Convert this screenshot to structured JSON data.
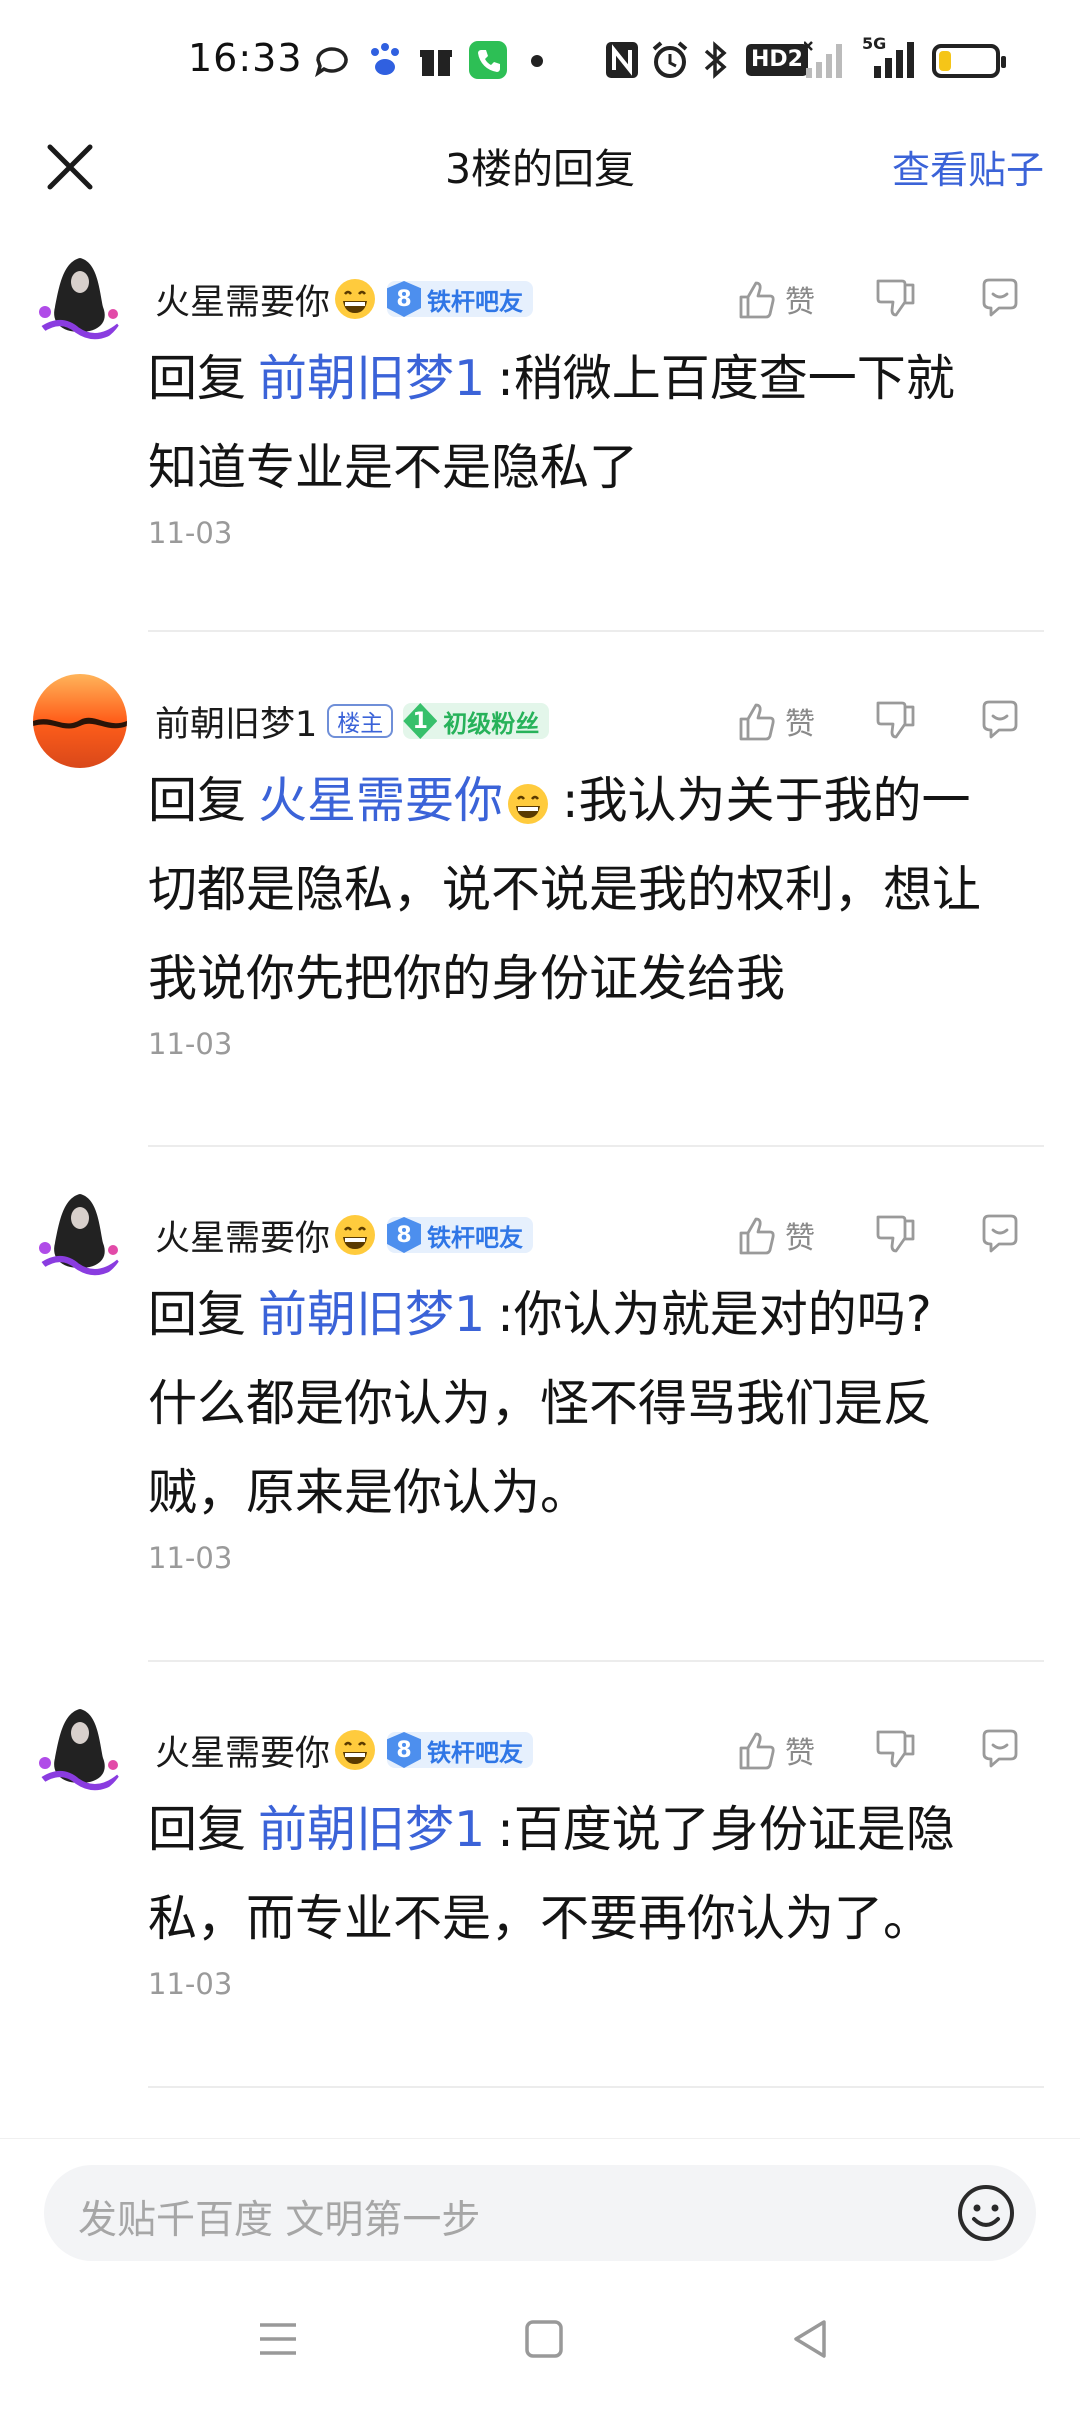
{
  "status_bar": {
    "time": "16:33",
    "network_label": "5G",
    "hd_label": "HD2",
    "battery_level": 0.2,
    "battery_color": "#f5c518"
  },
  "header": {
    "title": "3楼的回复",
    "view_post": "查看贴子",
    "close_icon": "close-icon"
  },
  "replies": [
    {
      "username": "火星需要你",
      "level": "8",
      "badge": "铁杆吧友",
      "badge_style": "blue",
      "is_owner": false,
      "prefix": "回复",
      "mention": "前朝旧梦1",
      "text_lines": [
        ":稍微上百度查一下就",
        "知道专业是不是隐私了"
      ],
      "date": "11-03",
      "like_label": "赞"
    },
    {
      "username": "前朝旧梦1",
      "owner_label": "楼主",
      "level": "1",
      "badge": "初级粉丝",
      "badge_style": "green",
      "is_owner": true,
      "prefix": "回复",
      "mention": "火星需要你",
      "text_lines": [
        ":我认为关于我的一",
        "切都是隐私，说不说是我的权利，想让",
        "我说你先把你的身份证发给我"
      ],
      "date": "11-03",
      "like_label": "赞"
    },
    {
      "username": "火星需要你",
      "level": "8",
      "badge": "铁杆吧友",
      "badge_style": "blue",
      "is_owner": false,
      "prefix": "回复",
      "mention": "前朝旧梦1",
      "text_lines": [
        ":你认为就是对的吗?",
        "什么都是你认为，怪不得骂我们是反",
        "贼，原来是你认为。"
      ],
      "date": "11-03",
      "like_label": "赞"
    },
    {
      "username": "火星需要你",
      "level": "8",
      "badge": "铁杆吧友",
      "badge_style": "blue",
      "is_owner": false,
      "prefix": "回复",
      "mention": "前朝旧梦1",
      "text_lines": [
        ":百度说了身份证是隐",
        "私，而专业不是，不要再你认为了。"
      ],
      "date": "11-03",
      "like_label": "赞"
    }
  ],
  "composer": {
    "placeholder": "发贴千百度 文明第一步"
  },
  "colors": {
    "accent": "#3b63d8",
    "text": "#141414",
    "muted": "#9a9a9a"
  }
}
